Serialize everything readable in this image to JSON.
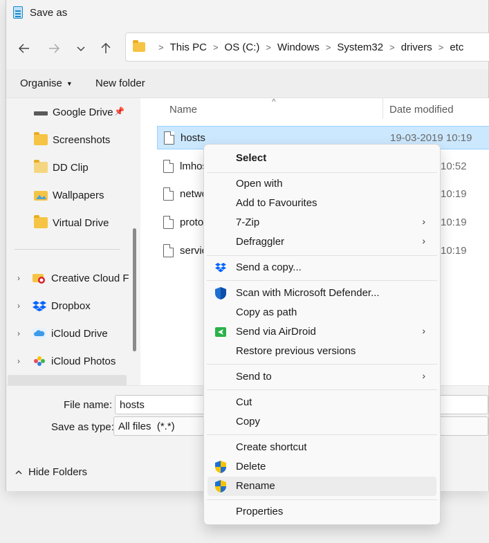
{
  "window": {
    "title": "Save as"
  },
  "address": {
    "crumbs": [
      "This PC",
      "OS (C:)",
      "Windows",
      "System32",
      "drivers",
      "etc"
    ]
  },
  "toolbar": {
    "organise": "Organise",
    "new_folder": "New folder"
  },
  "nav": {
    "pinned": [
      {
        "label": "Google Drive",
        "icon": "drive-icon"
      },
      {
        "label": "Screenshots",
        "icon": "folder-icon"
      },
      {
        "label": "DD Clip",
        "icon": "folder-icon"
      },
      {
        "label": "Wallpapers",
        "icon": "wallpaper-folder-icon"
      },
      {
        "label": "Virtual Drive",
        "icon": "folder-icon"
      }
    ],
    "roots": [
      {
        "label": "Creative Cloud F",
        "icon": "creative-cloud-icon"
      },
      {
        "label": "Dropbox",
        "icon": "dropbox-icon"
      },
      {
        "label": "iCloud Drive",
        "icon": "icloud-drive-icon"
      },
      {
        "label": "iCloud Photos",
        "icon": "icloud-photos-icon"
      }
    ]
  },
  "columns": {
    "name": "Name",
    "date": "Date modified"
  },
  "files": [
    {
      "name": "hosts",
      "date": "19-03-2019 10:19"
    },
    {
      "name": "lmhos",
      "date": "10:52"
    },
    {
      "name": "netwo",
      "date": "10:19"
    },
    {
      "name": "protoc",
      "date": "10:19"
    },
    {
      "name": "servic",
      "date": "10:19"
    }
  ],
  "bottom": {
    "file_name_label": "File name:",
    "file_name_value": "hosts",
    "save_type_label": "Save as type:",
    "save_type_value": "All files  (*.*)",
    "hide_folders": "Hide Folders"
  },
  "context_menu": {
    "select": "Select",
    "open_with": "Open with",
    "add_favourites": "Add to Favourites",
    "zip": "7-Zip",
    "defraggler": "Defraggler",
    "send_copy": "Send a copy...",
    "scan_defender": "Scan with Microsoft Defender...",
    "copy_path": "Copy as path",
    "airdroid": "Send via AirDroid",
    "restore": "Restore previous versions",
    "send_to": "Send to",
    "cut": "Cut",
    "copy": "Copy",
    "create_shortcut": "Create shortcut",
    "delete": "Delete",
    "rename": "Rename",
    "properties": "Properties"
  },
  "colors": {
    "selection": "#cce8ff",
    "accent": "#0067c0",
    "folder": "#f6c445"
  }
}
